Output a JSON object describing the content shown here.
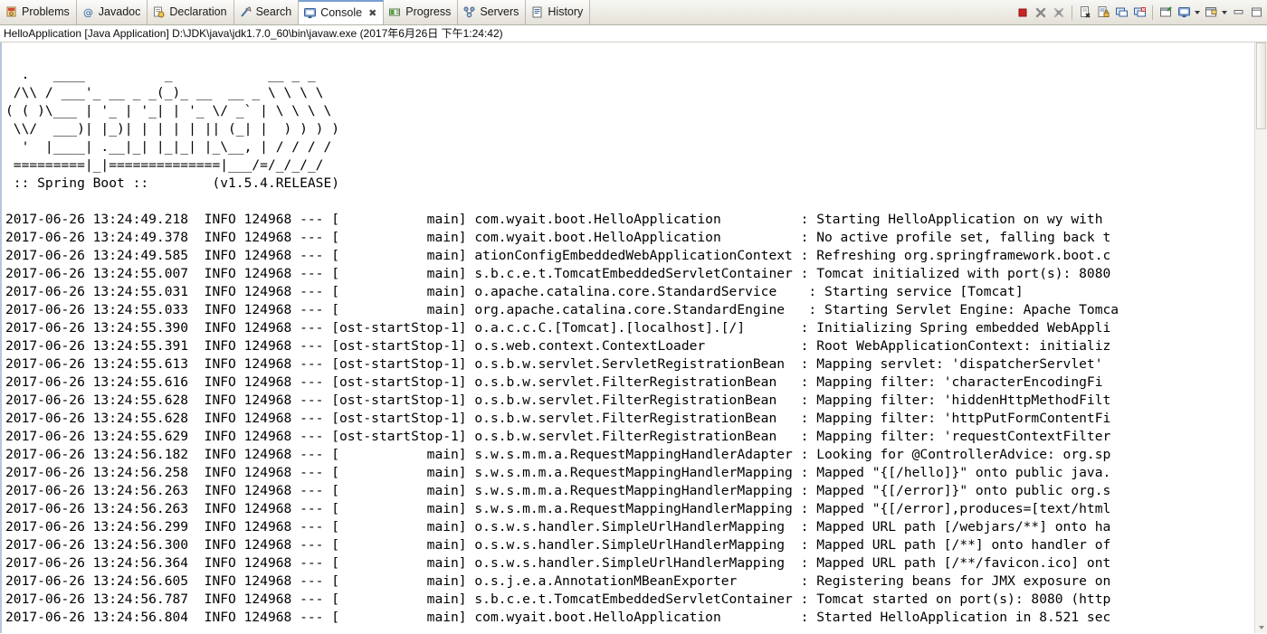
{
  "tabs": [
    {
      "label": "Problems",
      "icon": "problems-icon",
      "active": false,
      "closable": false
    },
    {
      "label": "Javadoc",
      "icon": "javadoc-icon",
      "active": false,
      "closable": false
    },
    {
      "label": "Declaration",
      "icon": "declaration-icon",
      "active": false,
      "closable": false
    },
    {
      "label": "Search",
      "icon": "search-icon",
      "active": false,
      "closable": false
    },
    {
      "label": "Console",
      "icon": "console-icon",
      "active": true,
      "closable": true,
      "close_glyph": "✖"
    },
    {
      "label": "Progress",
      "icon": "progress-icon",
      "active": false,
      "closable": false
    },
    {
      "label": "Servers",
      "icon": "servers-icon",
      "active": false,
      "closable": false
    },
    {
      "label": "History",
      "icon": "history-icon",
      "active": false,
      "closable": false
    }
  ],
  "toolbar": {
    "buttons": [
      {
        "name": "terminate-button",
        "tip": "Terminate"
      },
      {
        "name": "remove-launch-button",
        "tip": "Remove Launch"
      },
      {
        "name": "remove-all-terminated-button",
        "tip": "Remove All Terminated Launches"
      },
      {
        "name": "clear-console-button",
        "tip": "Clear Console"
      },
      {
        "name": "scroll-lock-button",
        "tip": "Scroll Lock"
      },
      {
        "name": "show-console-on-output-button",
        "tip": "Show Console When Standard Out Changes"
      },
      {
        "name": "show-console-on-error-button",
        "tip": "Show Console When Standard Error Changes"
      },
      {
        "name": "pin-console-button",
        "tip": "Pin Console"
      },
      {
        "name": "display-selected-console-button",
        "tip": "Display Selected Console"
      },
      {
        "name": "open-console-button",
        "tip": "Open Console"
      },
      {
        "name": "minimize-button",
        "tip": "Minimize"
      },
      {
        "name": "maximize-button",
        "tip": "Maximize"
      }
    ]
  },
  "console": {
    "title": "HelloApplication [Java Application] D:\\JDK\\java\\jdk1.7.0_60\\bin\\javaw.exe (2017年6月26日 下午1:24:42)",
    "banner": "\n  .   ____          _            __ _ _\n /\\\\ / ___'_ __ _ _(_)_ __  __ _ \\ \\ \\ \\\n( ( )\\___ | '_ | '_| | '_ \\/ _` | \\ \\ \\ \\\n \\\\/  ___)| |_)| | | | | || (_| |  ) ) ) )\n  '  |____| .__|_| |_|_| |_\\__, | / / / /\n =========|_|==============|___/=/_/_/_/\n :: Spring Boot ::        (v1.5.4.RELEASE)\n",
    "log_lines": [
      "2017-06-26 13:24:49.218  INFO 124968 --- [           main] com.wyait.boot.HelloApplication          : Starting HelloApplication on wy with",
      "2017-06-26 13:24:49.378  INFO 124968 --- [           main] com.wyait.boot.HelloApplication          : No active profile set, falling back t",
      "2017-06-26 13:24:49.585  INFO 124968 --- [           main] ationConfigEmbeddedWebApplicationContext : Refreshing org.springframework.boot.c",
      "2017-06-26 13:24:55.007  INFO 124968 --- [           main] s.b.c.e.t.TomcatEmbeddedServletContainer : Tomcat initialized with port(s): 8080",
      "2017-06-26 13:24:55.031  INFO 124968 --- [           main] o.apache.catalina.core.StandardService    : Starting service [Tomcat]",
      "2017-06-26 13:24:55.033  INFO 124968 --- [           main] org.apache.catalina.core.StandardEngine   : Starting Servlet Engine: Apache Tomca",
      "2017-06-26 13:24:55.390  INFO 124968 --- [ost-startStop-1] o.a.c.c.C.[Tomcat].[localhost].[/]       : Initializing Spring embedded WebAppli",
      "2017-06-26 13:24:55.391  INFO 124968 --- [ost-startStop-1] o.s.web.context.ContextLoader            : Root WebApplicationContext: initializ",
      "2017-06-26 13:24:55.613  INFO 124968 --- [ost-startStop-1] o.s.b.w.servlet.ServletRegistrationBean  : Mapping servlet: 'dispatcherServlet'",
      "2017-06-26 13:24:55.616  INFO 124968 --- [ost-startStop-1] o.s.b.w.servlet.FilterRegistrationBean   : Mapping filter: 'characterEncodingFi",
      "2017-06-26 13:24:55.628  INFO 124968 --- [ost-startStop-1] o.s.b.w.servlet.FilterRegistrationBean   : Mapping filter: 'hiddenHttpMethodFilt",
      "2017-06-26 13:24:55.628  INFO 124968 --- [ost-startStop-1] o.s.b.w.servlet.FilterRegistrationBean   : Mapping filter: 'httpPutFormContentFi",
      "2017-06-26 13:24:55.629  INFO 124968 --- [ost-startStop-1] o.s.b.w.servlet.FilterRegistrationBean   : Mapping filter: 'requestContextFilter",
      "2017-06-26 13:24:56.182  INFO 124968 --- [           main] s.w.s.m.m.a.RequestMappingHandlerAdapter : Looking for @ControllerAdvice: org.sp",
      "2017-06-26 13:24:56.258  INFO 124968 --- [           main] s.w.s.m.m.a.RequestMappingHandlerMapping : Mapped \"{[/hello]}\" onto public java.",
      "2017-06-26 13:24:56.263  INFO 124968 --- [           main] s.w.s.m.m.a.RequestMappingHandlerMapping : Mapped \"{[/error]}\" onto public org.s",
      "2017-06-26 13:24:56.263  INFO 124968 --- [           main] s.w.s.m.m.a.RequestMappingHandlerMapping : Mapped \"{[/error],produces=[text/html",
      "2017-06-26 13:24:56.299  INFO 124968 --- [           main] o.s.w.s.handler.SimpleUrlHandlerMapping  : Mapped URL path [/webjars/**] onto ha",
      "2017-06-26 13:24:56.300  INFO 124968 --- [           main] o.s.w.s.handler.SimpleUrlHandlerMapping  : Mapped URL path [/**] onto handler of",
      "2017-06-26 13:24:56.364  INFO 124968 --- [           main] o.s.w.s.handler.SimpleUrlHandlerMapping  : Mapped URL path [/**/favicon.ico] ont",
      "2017-06-26 13:24:56.605  INFO 124968 --- [           main] o.s.j.e.a.AnnotationMBeanExporter        : Registering beans for JMX exposure on",
      "2017-06-26 13:24:56.787  INFO 124968 --- [           main] s.b.c.e.t.TomcatEmbeddedServletContainer : Tomcat started on port(s): 8080 (http",
      "2017-06-26 13:24:56.804  INFO 124968 --- [           main] com.wyait.boot.HelloApplication          : Started HelloApplication in 8.521 sec"
    ]
  },
  "colors": {
    "accent": "#7a9fd4",
    "text": "#000000",
    "chrome": "#e3e0d8",
    "stop_red": "#cc2222"
  }
}
